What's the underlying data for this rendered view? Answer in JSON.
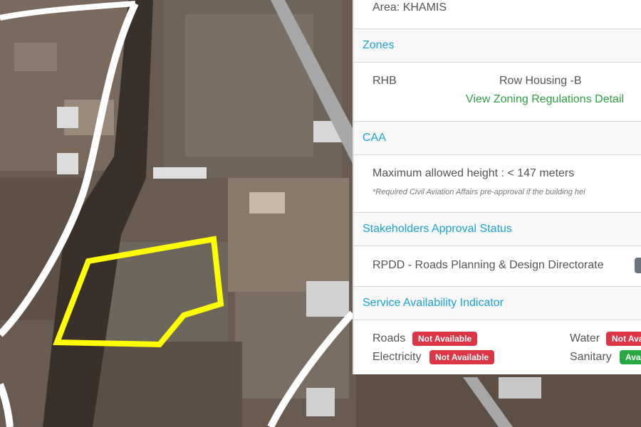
{
  "area": {
    "text": "Area: KHAMIS"
  },
  "zones": {
    "heading": "Zones",
    "code": "RHB",
    "name": "Row Housing -B",
    "link": "View Zoning Regulations Detail"
  },
  "caa": {
    "heading": "CAA",
    "height_text": "Maximum allowed height : < 147 meters",
    "note": "*Required Civil Aviation Affairs pre-approval if the building hei"
  },
  "stakeholders": {
    "heading": "Stakeholders Approval Status",
    "item": "RPDD - Roads Planning & Design Directorate"
  },
  "services": {
    "heading": "Service Availability Indicator",
    "items": [
      {
        "label": "Roads",
        "status": "Not Available"
      },
      {
        "label": "Water",
        "status": "Not Avai"
      },
      {
        "label": "Electricity",
        "status": "Not Available"
      },
      {
        "label": "Sanitary",
        "status": "Ava"
      }
    ]
  },
  "colors": {
    "accent": "#1aa3d6",
    "link": "#2ea043",
    "not_available": "#dc3545",
    "available": "#28a745",
    "parcel_outline": "#ffff00"
  }
}
